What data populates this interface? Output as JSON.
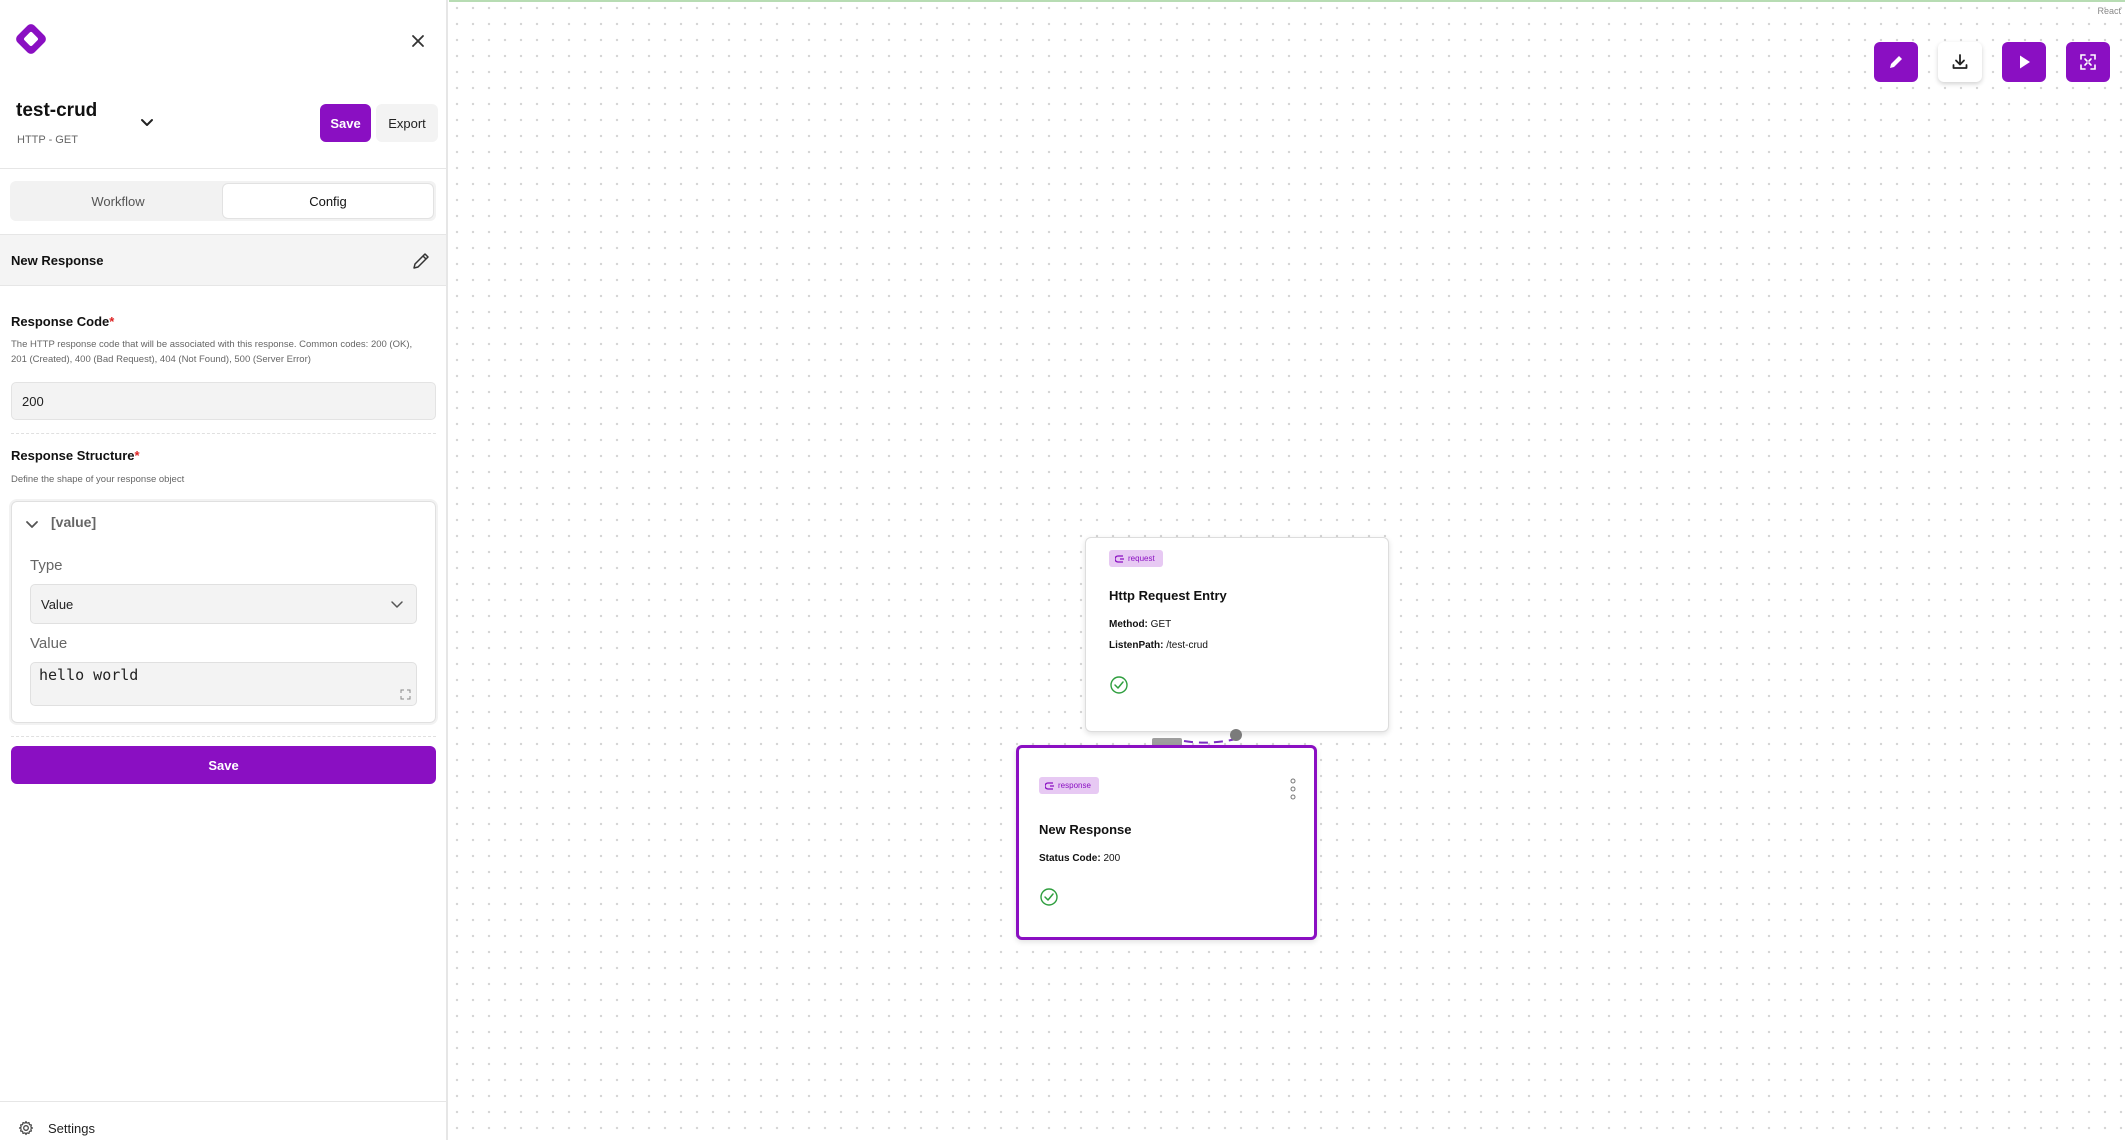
{
  "project": {
    "name": "test-crud",
    "method": "HTTP - GET"
  },
  "header": {
    "save_label": "Save",
    "export_label": "Export"
  },
  "tabs": [
    {
      "label": "Workflow"
    },
    {
      "label": "Config"
    }
  ],
  "panel": {
    "node_title": "New Response",
    "response_code": {
      "label": "Response Code",
      "required_mark": "*",
      "description": "The HTTP response code that will be associated with this response. Common codes: 200 (OK), 201 (Created), 400 (Bad Request), 404 (Not Found), 500 (Server Error)",
      "value": "200"
    },
    "response_structure": {
      "label": "Response Structure",
      "required_mark": "*",
      "description": "Define the shape of your response object",
      "key": "[value]",
      "type_label": "Type",
      "type_value": "Value",
      "value_label": "Value",
      "value": "hello world"
    },
    "save_label": "Save"
  },
  "settings": {
    "label": "Settings"
  },
  "canvas": {
    "corner_label": "React",
    "nodes": {
      "request": {
        "badge": "request",
        "title": "Http Request Entry",
        "method_key": "Method:",
        "method_value": "GET",
        "path_key": "ListenPath:",
        "path_value": "/test-crud"
      },
      "response": {
        "badge": "response",
        "title": "New Response",
        "status_key": "Status Code:",
        "status_value": "200"
      }
    }
  },
  "colors": {
    "accent": "#8a0fc2",
    "badge_bg": "#e7c9f3",
    "success": "#2e9e3e"
  }
}
